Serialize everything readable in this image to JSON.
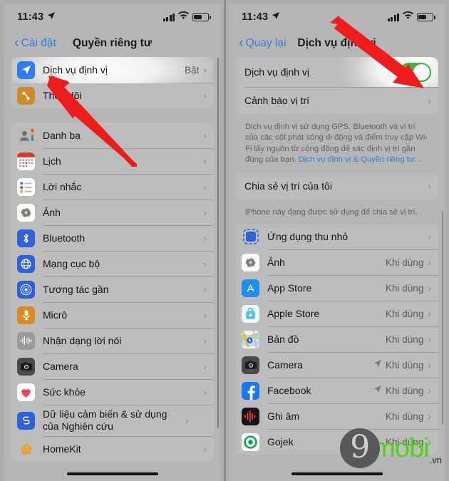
{
  "status_bar": {
    "time": "11:43",
    "location_icon": "location-arrow-icon",
    "signal_icon": "cellular-signal-icon",
    "wifi_icon": "wifi-icon",
    "battery_icon": "battery-icon"
  },
  "left_phone": {
    "nav": {
      "back_label": "Cài đặt",
      "title": "Quyền riêng tư"
    },
    "group1": [
      {
        "label": "Dịch vụ định vị",
        "value": "Bật",
        "icon": "location-services-icon",
        "icon_color": "#2f7cf6"
      },
      {
        "label": "Theo dõi",
        "value": "",
        "icon": "tracking-icon",
        "icon_color": "#cf8b2b"
      }
    ],
    "group2": [
      {
        "label": "Danh bạ",
        "value": "",
        "icon": "contacts-icon",
        "icon_color": "#b4b4b4"
      },
      {
        "label": "Lịch",
        "value": "",
        "icon": "calendar-icon",
        "icon_color": "#ffffff"
      },
      {
        "label": "Lời nhắc",
        "value": "",
        "icon": "reminders-icon",
        "icon_color": "#ffffff"
      },
      {
        "label": "Ảnh",
        "value": "",
        "icon": "photos-icon",
        "icon_color": "#ffffff"
      },
      {
        "label": "Bluetooth",
        "value": "",
        "icon": "bluetooth-icon",
        "icon_color": "#2f62d8"
      },
      {
        "label": "Mạng cục bộ",
        "value": "",
        "icon": "local-network-icon",
        "icon_color": "#2f62d8"
      },
      {
        "label": "Tương tác gần",
        "value": "",
        "icon": "nearby-interactions-icon",
        "icon_color": "#2f62d8"
      },
      {
        "label": "Micrô",
        "value": "",
        "icon": "microphone-icon",
        "icon_color": "#d98c22"
      },
      {
        "label": "Nhận dạng lời nói",
        "value": "",
        "icon": "speech-recognition-icon",
        "icon_color": "#8e8e93"
      },
      {
        "label": "Camera",
        "value": "",
        "icon": "camera-icon",
        "icon_color": "#4a4a4a"
      },
      {
        "label": "Sức khỏe",
        "value": "",
        "icon": "health-icon",
        "icon_color": "#ffffff"
      },
      {
        "label": "Dữ liệu cảm biến & sử dụng của Nghiên cứu",
        "value": "",
        "icon": "research-sensor-icon",
        "icon_color": "#2f62d8"
      },
      {
        "label": "HomeKit",
        "value": "",
        "icon": "homekit-icon",
        "icon_color": "#f0a53c"
      }
    ]
  },
  "right_phone": {
    "nav": {
      "back_label": "Quay lại",
      "title": "Dịch vụ định vị"
    },
    "toggle_row": {
      "label": "Dịch vụ định vị",
      "toggle_state": "on",
      "toggle_color": "#3fb54a"
    },
    "alerts_row": {
      "label": "Cảnh báo vị trí"
    },
    "footnote_1": {
      "text": "Dịch vụ định vị sử dụng GPS, Bluetooth và vị trí của các cột phát sóng di động và điểm truy cập Wi-Fi lấy nguồn từ cộng đồng để xác định vị trí gần đúng của bạn. ",
      "link": "Dịch vụ định vị & Quyền riêng tư…"
    },
    "share_row": {
      "label": "Chia sẻ vị trí của tôi"
    },
    "footnote_2": "iPhone này đang được sử dụng để chia sẻ vị trí.",
    "apps": [
      {
        "label": "Ứng dụng thu nhỏ",
        "value": "",
        "arrow": false,
        "icon": "app-clips-icon",
        "icon_color": "#2f62d8"
      },
      {
        "label": "Ảnh",
        "value": "Khi dùng",
        "arrow": false,
        "icon": "photos-icon",
        "icon_color": "#ffffff"
      },
      {
        "label": "App Store",
        "value": "Khi dùng",
        "arrow": false,
        "icon": "app-store-icon",
        "icon_color": "#1f8ef0"
      },
      {
        "label": "Apple Store",
        "value": "Khi dùng",
        "arrow": false,
        "icon": "apple-store-icon",
        "icon_color": "#e9f6fb"
      },
      {
        "label": "Bản đồ",
        "value": "Khi dùng",
        "arrow": false,
        "icon": "maps-icon",
        "icon_color": "#ffffff"
      },
      {
        "label": "Camera",
        "value": "Khi dùng",
        "arrow": true,
        "icon": "camera-icon",
        "icon_color": "#4a4a4a"
      },
      {
        "label": "Facebook",
        "value": "Khi dùng",
        "arrow": true,
        "icon": "facebook-icon",
        "icon_color": "#1877f2"
      },
      {
        "label": "Ghi âm",
        "value": "Khi dùng",
        "arrow": false,
        "icon": "voice-memos-icon",
        "icon_color": "#1c1c1c"
      },
      {
        "label": "Gojek",
        "value": "Khi dùng",
        "arrow": false,
        "icon": "gojek-icon",
        "icon_color": "#ffffff"
      }
    ]
  },
  "watermark": {
    "logo_char": "9",
    "brand": "mobi",
    "tld": ".vn",
    "brand_color": "#4dd419"
  }
}
